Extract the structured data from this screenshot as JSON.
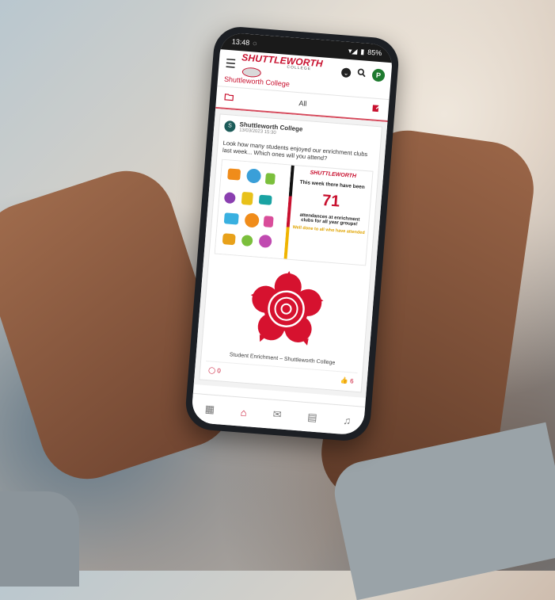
{
  "status": {
    "time": "13:48",
    "battery": "85%"
  },
  "header": {
    "brand_word": "SHUTTLEWORTH",
    "brand_sub": "COLLEGE",
    "avatar_letter": "P"
  },
  "breadcrumb": "Shuttleworth College",
  "filter": {
    "label": "All"
  },
  "post": {
    "author": "Shuttleworth College",
    "author_initial": "S",
    "timestamp": "13/03/2023 15:30",
    "text": "Look how many students enjoyed our enrichment clubs last week... Which ones will you attend?",
    "promo": {
      "brand": "SHUTTLEWORTH",
      "line1": "This week there have been",
      "number": "71",
      "line2": "attendances at enrichment clubs for all year groups!",
      "line3": "Well done to all who have attended"
    },
    "caption": "Student Enrichment – Shuttleworth College",
    "comments": "0",
    "likes": "6"
  },
  "colors": {
    "accent": "#c8102e",
    "avatar_green": "#1e7a2f"
  },
  "icons": {
    "menu": "hamburger-icon",
    "search": "search-icon",
    "folder": "folder-icon",
    "compose": "edit-icon",
    "comment": "comment-icon",
    "like": "thumbs-up-icon",
    "apps": "grid-icon",
    "home": "home-icon",
    "mail": "mail-icon",
    "calendar": "calendar-icon",
    "bell": "bell-icon"
  }
}
